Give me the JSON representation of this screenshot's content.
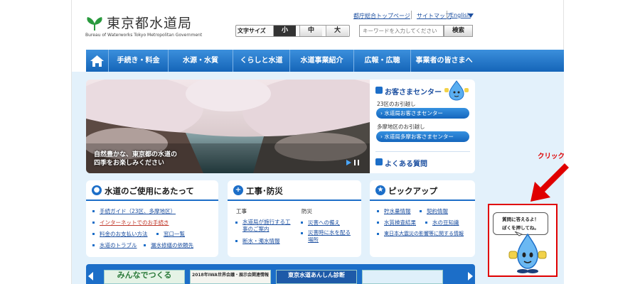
{
  "header": {
    "logo_jp": "東京都水道局",
    "logo_en": "Bureau of Waterworks Tokyo Metropolitan Government",
    "links": [
      "都庁総合トップページ",
      "サイトマップ",
      "English"
    ],
    "font_size_label": "文字サイズ",
    "font_sizes": [
      "小",
      "中",
      "大"
    ],
    "font_size_selected": "小",
    "search_placeholder": "キーワードを入力してください",
    "search_button": "検索"
  },
  "nav": {
    "home_icon": "home-icon",
    "items": [
      "手続き・料金",
      "水源・水質",
      "くらしと水道",
      "水道事業紹介",
      "広報・広聴",
      "事業者の皆さまへ"
    ]
  },
  "hero": {
    "caption_line1": "自然豊かな、東京都の水道の",
    "caption_line2": "四季をお楽しみください"
  },
  "customer_center": {
    "title": "お客さまセンター",
    "area1_label": "23区のお引越し",
    "area1_button": "水道局お客さまセンター",
    "area2_label": "多摩地区のお引越し",
    "area2_button": "水道局多摩お客さまセンター",
    "faq": "よくある質問"
  },
  "boxes": {
    "usage": {
      "title": "水道のご使用にあたって",
      "links": [
        "手続ガイド（23区、多摩地区）",
        "インターネットでのお手続き",
        "料金のお支払い方法",
        "窓口一覧",
        "水道のトラブル",
        "漏水修繕の依頼先"
      ]
    },
    "works": {
      "title": "工事･防災",
      "cat1": "工事",
      "cat2": "防災",
      "cat1_links": [
        "水道局が施行する工事のご案内",
        "断水・濁水情報"
      ],
      "cat2_links": [
        "災害への備え",
        "災害時に水を配る場所"
      ]
    },
    "pickup": {
      "title": "ピックアップ",
      "links": [
        "貯水量情報",
        "契約情報",
        "水質検査結果",
        "水の豆知識",
        "東日本大震災の影響等に関する情報"
      ]
    }
  },
  "banners": [
    "みんなでつくる",
    "2018年IWA世界会議・展示会関連情報",
    "東京水道あんしん診断",
    ""
  ],
  "annotation": {
    "click_label": "クリック",
    "mascot_line1": "質問に答えるよ！",
    "mascot_line2": "ぼくを押してね。"
  },
  "colors": {
    "nav_blue": "#1565b8",
    "accent_blue": "#1c6ec8",
    "annotation_red": "#e00000"
  }
}
